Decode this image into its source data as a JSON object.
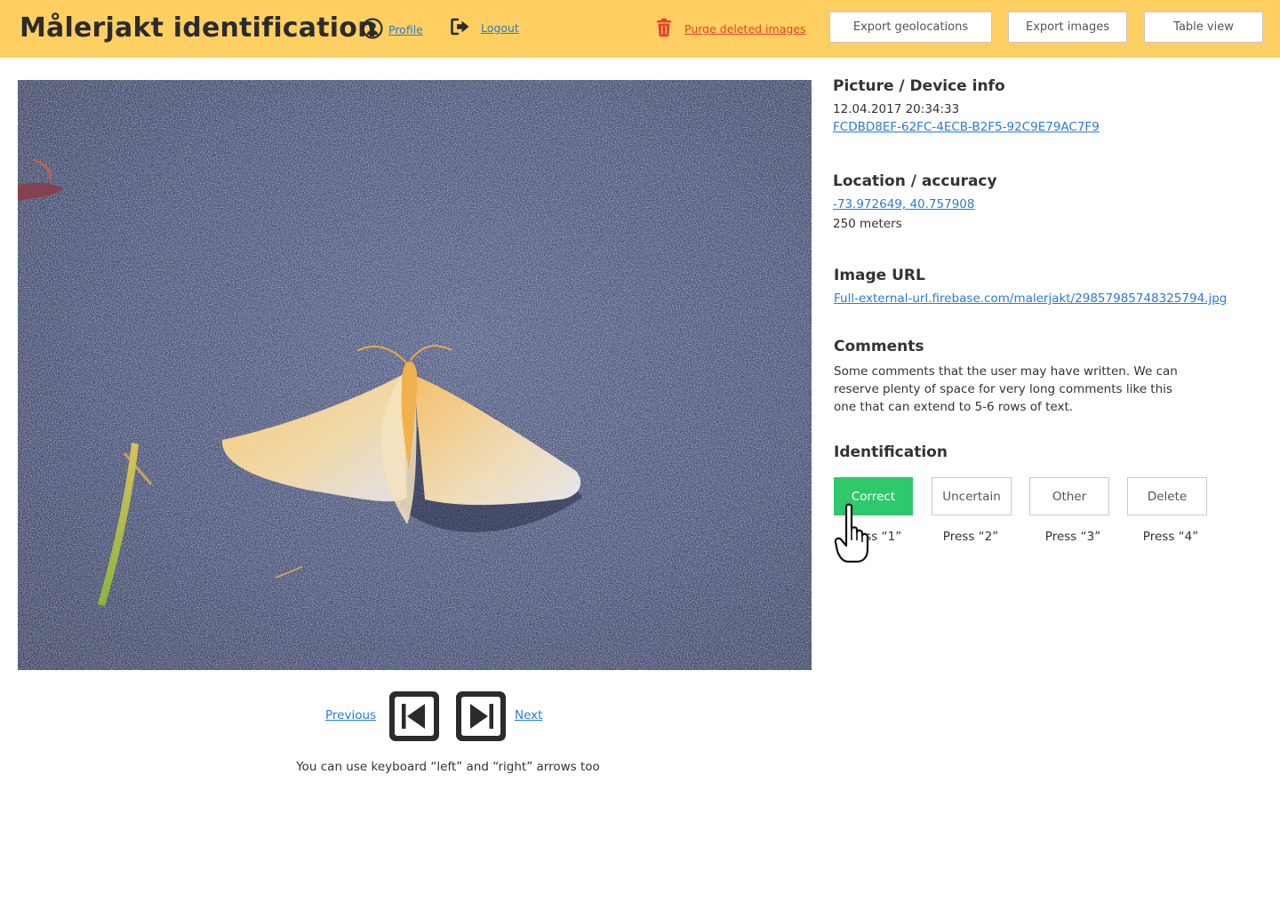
{
  "header": {
    "title": "Målerjakt identification",
    "profile_label": "Profile",
    "logout_label": "Logout",
    "purge_label": "Purge deleted images",
    "export_geo_label": "Export geolocations",
    "export_images_label": "Export images",
    "table_view_label": "Table view"
  },
  "photo": {
    "subject": "moth-on-asphalt"
  },
  "navigation": {
    "previous_label": "Previous",
    "next_label": "Next",
    "hint": "You can use keyboard “left” and “right” arrows too"
  },
  "info": {
    "device_title": "Picture / Device info",
    "datetime": "12.04.2017 20:34:33",
    "device_id": "FCDBD8EF-62FC-4ECB-B2F5-92C9E79AC7F9",
    "location_title": "Location / accuracy",
    "coordinates": "-73.972649, 40.757908",
    "accuracy": "250 meters",
    "url_title": "Image URL",
    "image_url": "Full-external-url.firebase.com/malerjakt/29857985748325794.jpg",
    "comments_title": "Comments",
    "comments_text": "Some comments that the user may have written. We can reserve plenty of space for very long comments like this one that can extend to 5-6 rows of text."
  },
  "identification": {
    "title": "Identification",
    "buttons": [
      {
        "label": "Correct",
        "shortcut": "Press “1”"
      },
      {
        "label": "Uncertain",
        "shortcut": "Press “2”"
      },
      {
        "label": "Other",
        "shortcut": "Press “3”"
      },
      {
        "label": "Delete",
        "shortcut": "Press “4”"
      }
    ]
  },
  "colors": {
    "header_bg": "#ffd061",
    "link": "#2b7bd1",
    "danger": "#e8402f",
    "correct": "#2fc86a"
  },
  "icons": {
    "profile": "user-circle-icon",
    "logout": "sign-out-icon",
    "purge": "trash-icon",
    "previous": "step-back-icon",
    "next": "step-forward-icon",
    "pointer": "hand-pointer-cursor"
  }
}
